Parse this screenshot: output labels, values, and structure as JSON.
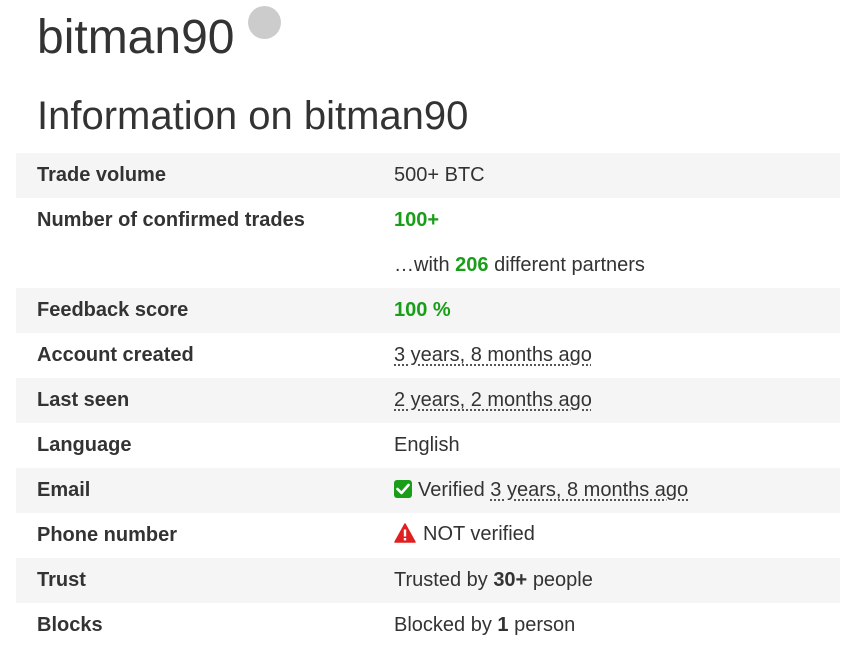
{
  "profile": {
    "username": "bitman90",
    "status_color": "#cccccc"
  },
  "section": {
    "title": "Information on bitman90"
  },
  "colors": {
    "positive": "#1a9e1a",
    "warning": "#e02020"
  },
  "info": {
    "trade_volume": {
      "label": "Trade volume",
      "value": "500+ BTC"
    },
    "confirmed_trades": {
      "label": "Number of confirmed trades",
      "value": "100+",
      "partners_prefix": "…with",
      "partners_count": "206",
      "partners_suffix": "different partners"
    },
    "feedback_score": {
      "label": "Feedback score",
      "value": "100 %"
    },
    "account_created": {
      "label": "Account created",
      "value": "3 years, 8 months ago"
    },
    "last_seen": {
      "label": "Last seen",
      "value": "2 years, 2 months ago"
    },
    "language": {
      "label": "Language",
      "value": "English"
    },
    "email": {
      "label": "Email",
      "icon": "check-square-icon",
      "status": "Verified",
      "when": "3 years, 8 months ago"
    },
    "phone": {
      "label": "Phone number",
      "icon": "warning-triangle-icon",
      "status": "NOT verified"
    },
    "trust": {
      "label": "Trust",
      "prefix": "Trusted by",
      "count": "30+",
      "suffix": "people"
    },
    "blocks": {
      "label": "Blocks",
      "prefix": "Blocked by",
      "count": "1",
      "suffix": "person"
    }
  }
}
